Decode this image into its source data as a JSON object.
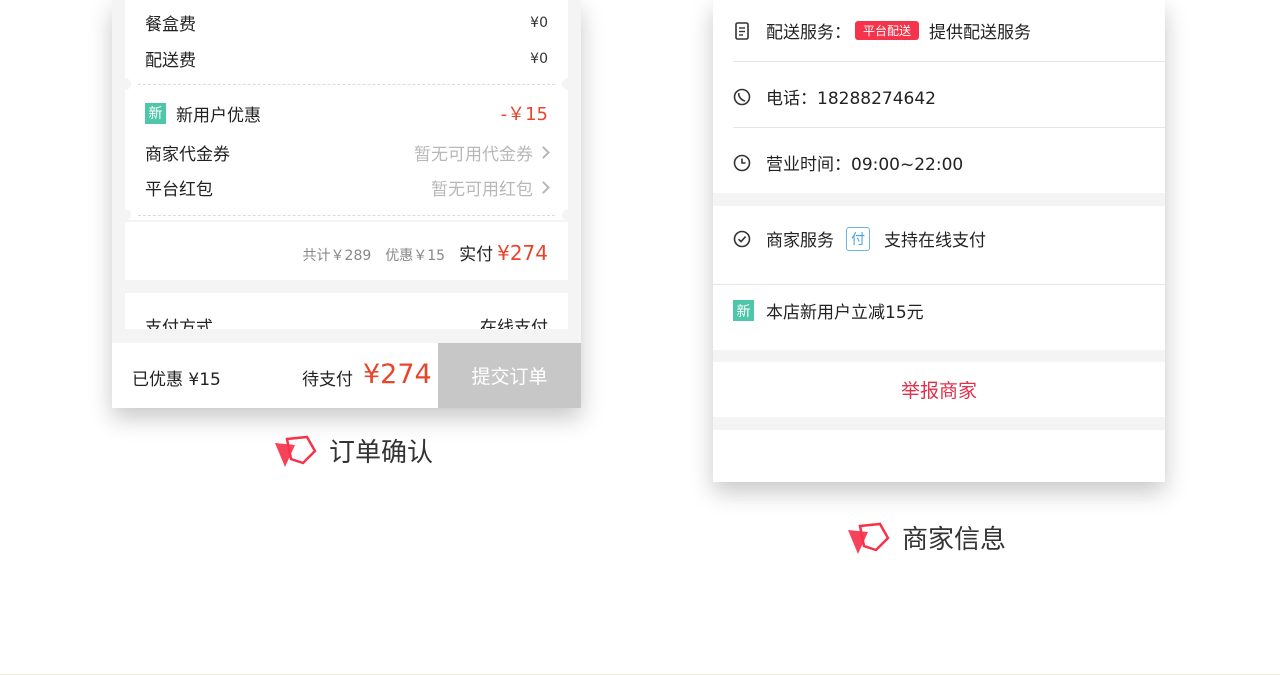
{
  "order": {
    "fees": [
      {
        "label": "餐盒费",
        "value": "¥0"
      },
      {
        "label": "配送费",
        "value": "¥0"
      }
    ],
    "new_user_badge": "新",
    "new_user_label": "新用户优惠",
    "new_user_value": "-￥15",
    "merchant_coupon_label": "商家代金券",
    "merchant_coupon_value": "暂无可用代金券",
    "platform_redpack_label": "平台红包",
    "platform_redpack_value": "暂无可用红包",
    "total_text": "共计￥289",
    "discount_text": "优惠￥15",
    "paid_label": "实付",
    "paid_amount": "¥274",
    "pay_method_label": "支付方式",
    "pay_method_value": "在线支付",
    "bottom": {
      "discounted": "已优惠 ¥15",
      "pending_label": "待支付",
      "pending_amount": "¥274",
      "submit_label": "提交订单"
    },
    "caption": "订单确认"
  },
  "merchant": {
    "delivery_label": "配送服务：",
    "delivery_badge": "平台配送",
    "delivery_text": "提供配送服务",
    "phone_text": "电话：18288274642",
    "hours_text": "营业时间：09:00~22:00",
    "service_label": "商家服务",
    "service_badge": "付",
    "service_text": "支持在线支付",
    "promo_badge": "新",
    "promo_text": "本店新用户立减15元",
    "report_label": "举报商家",
    "caption": "商家信息"
  },
  "colors": {
    "accent_red": "#e8452c",
    "brand_pink": "#f5334b",
    "new_badge": "#4ec6a9",
    "submit_disabled": "#c7c7c7"
  },
  "icons": {
    "delivery": "document-icon",
    "phone": "phone-icon",
    "hours": "clock-icon",
    "service": "check-circle-icon",
    "caption_logo": "brand-logo-icon"
  }
}
